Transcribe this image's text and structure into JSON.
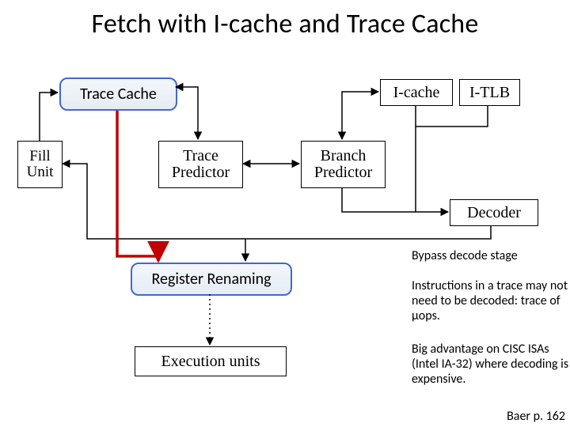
{
  "title": "Fetch with I-cache and Trace Cache",
  "boxes": {
    "trace_cache": "Trace Cache",
    "icache": "I-cache",
    "itlb": "I-TLB",
    "fill_unit": "Fill\nUnit",
    "trace_predictor": "Trace\nPredictor",
    "branch_predictor": "Branch\nPredictor",
    "decoder": "Decoder",
    "register_renaming": "Register Renaming",
    "execution_units": "Execution units"
  },
  "notes": {
    "bypass": "Bypass decode stage",
    "para1": "Instructions in a trace may not need to be decoded: trace of μops.",
    "para2": "Big advantage on CISC ISAs (Intel IA-32) where decoding is expensive."
  },
  "citation": "Baer p. 162"
}
